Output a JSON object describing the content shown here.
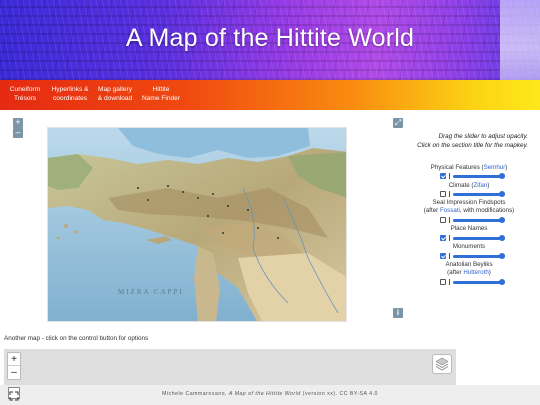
{
  "header": {
    "title": "A Map of the Hittite World"
  },
  "nav": {
    "items": [
      {
        "label": "Cuneiform\nTrésors"
      },
      {
        "label": "Hyperlinks &\ncoordinates"
      },
      {
        "label": "Map gallery\n& download"
      },
      {
        "label": "Hittite\nName Finder"
      }
    ]
  },
  "map_controls": {
    "zoom_in": "+",
    "zoom_out": "–",
    "info": "i"
  },
  "map_labels": {
    "sea": "MIZRA  CAPPI"
  },
  "panel": {
    "instructions_line1": "Drag the slider to adjust opacity.",
    "instructions_line2": "Click on the section title for the mapkey.",
    "layers": [
      {
        "name": "Physical Features",
        "credit": "Semhur",
        "checked": true,
        "opacity": 1.0
      },
      {
        "name": "Climate",
        "credit": "Zifan",
        "checked": false,
        "opacity": 1.0
      },
      {
        "name": "Seal Impression Findspots",
        "credit_prefix": "(after ",
        "credit": "Fossati",
        "credit_suffix": ", with modifications)",
        "checked": false,
        "opacity": 1.0
      },
      {
        "name": "Place Names",
        "checked": true,
        "opacity": 1.0
      },
      {
        "name": "Monuments",
        "checked": true,
        "opacity": 1.0
      },
      {
        "name": "Anatolian Beyliks",
        "credit_prefix": "(after ",
        "credit": "Hutteroth",
        "credit_suffix": ")",
        "checked": false,
        "opacity": 1.0
      }
    ]
  },
  "second_map": {
    "caption": "Another map - click on the control button for options",
    "zoom_in": "+",
    "zoom_out": "–"
  },
  "footer": {
    "author": "Michele Cammarosano, ",
    "work_title": "A Map of the Hittite World",
    "version": " (version xx). CC BY-SA 4.0"
  },
  "colors": {
    "accent": "#2f6fd6",
    "link": "#3366cc",
    "control": "#7b95a8"
  }
}
